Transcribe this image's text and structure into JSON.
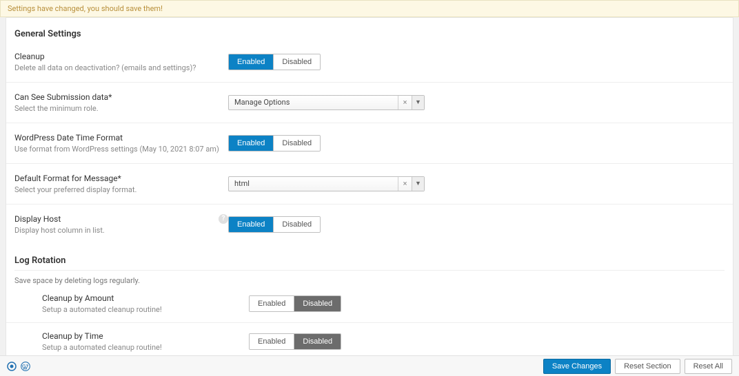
{
  "notice": {
    "text": "Settings have changed, you should save them!"
  },
  "sections": {
    "general": {
      "title": "General Settings"
    },
    "log_rotation": {
      "title": "Log Rotation",
      "desc": "Save space by deleting logs regularly."
    }
  },
  "common": {
    "enabled": "Enabled",
    "disabled": "Disabled"
  },
  "settings": {
    "cleanup": {
      "label": "Cleanup",
      "desc": "Delete all data on deactivation? (emails and settings)?",
      "value": "Enabled"
    },
    "submission_role": {
      "label": "Can See Submission data*",
      "desc": "Select the minimum role.",
      "value": "Manage Options"
    },
    "wp_datetime": {
      "label": "WordPress Date Time Format",
      "desc": "Use format from WordPress settings (May 10, 2021 8:07 am)",
      "value": "Enabled"
    },
    "default_format": {
      "label": "Default Format for Message*",
      "desc": "Select your preferred display format.",
      "value": "html"
    },
    "display_host": {
      "label": "Display Host",
      "desc": "Display host column in list.",
      "value": "Enabled"
    },
    "cleanup_amount": {
      "label": "Cleanup by Amount",
      "desc": "Setup a automated cleanup routine!",
      "value": "Disabled"
    },
    "cleanup_time": {
      "label": "Cleanup by Time",
      "desc": "Setup a automated cleanup routine!",
      "value": "Disabled"
    }
  },
  "footer": {
    "save": "Save Changes",
    "reset_section": "Reset Section",
    "reset_all": "Reset All"
  }
}
